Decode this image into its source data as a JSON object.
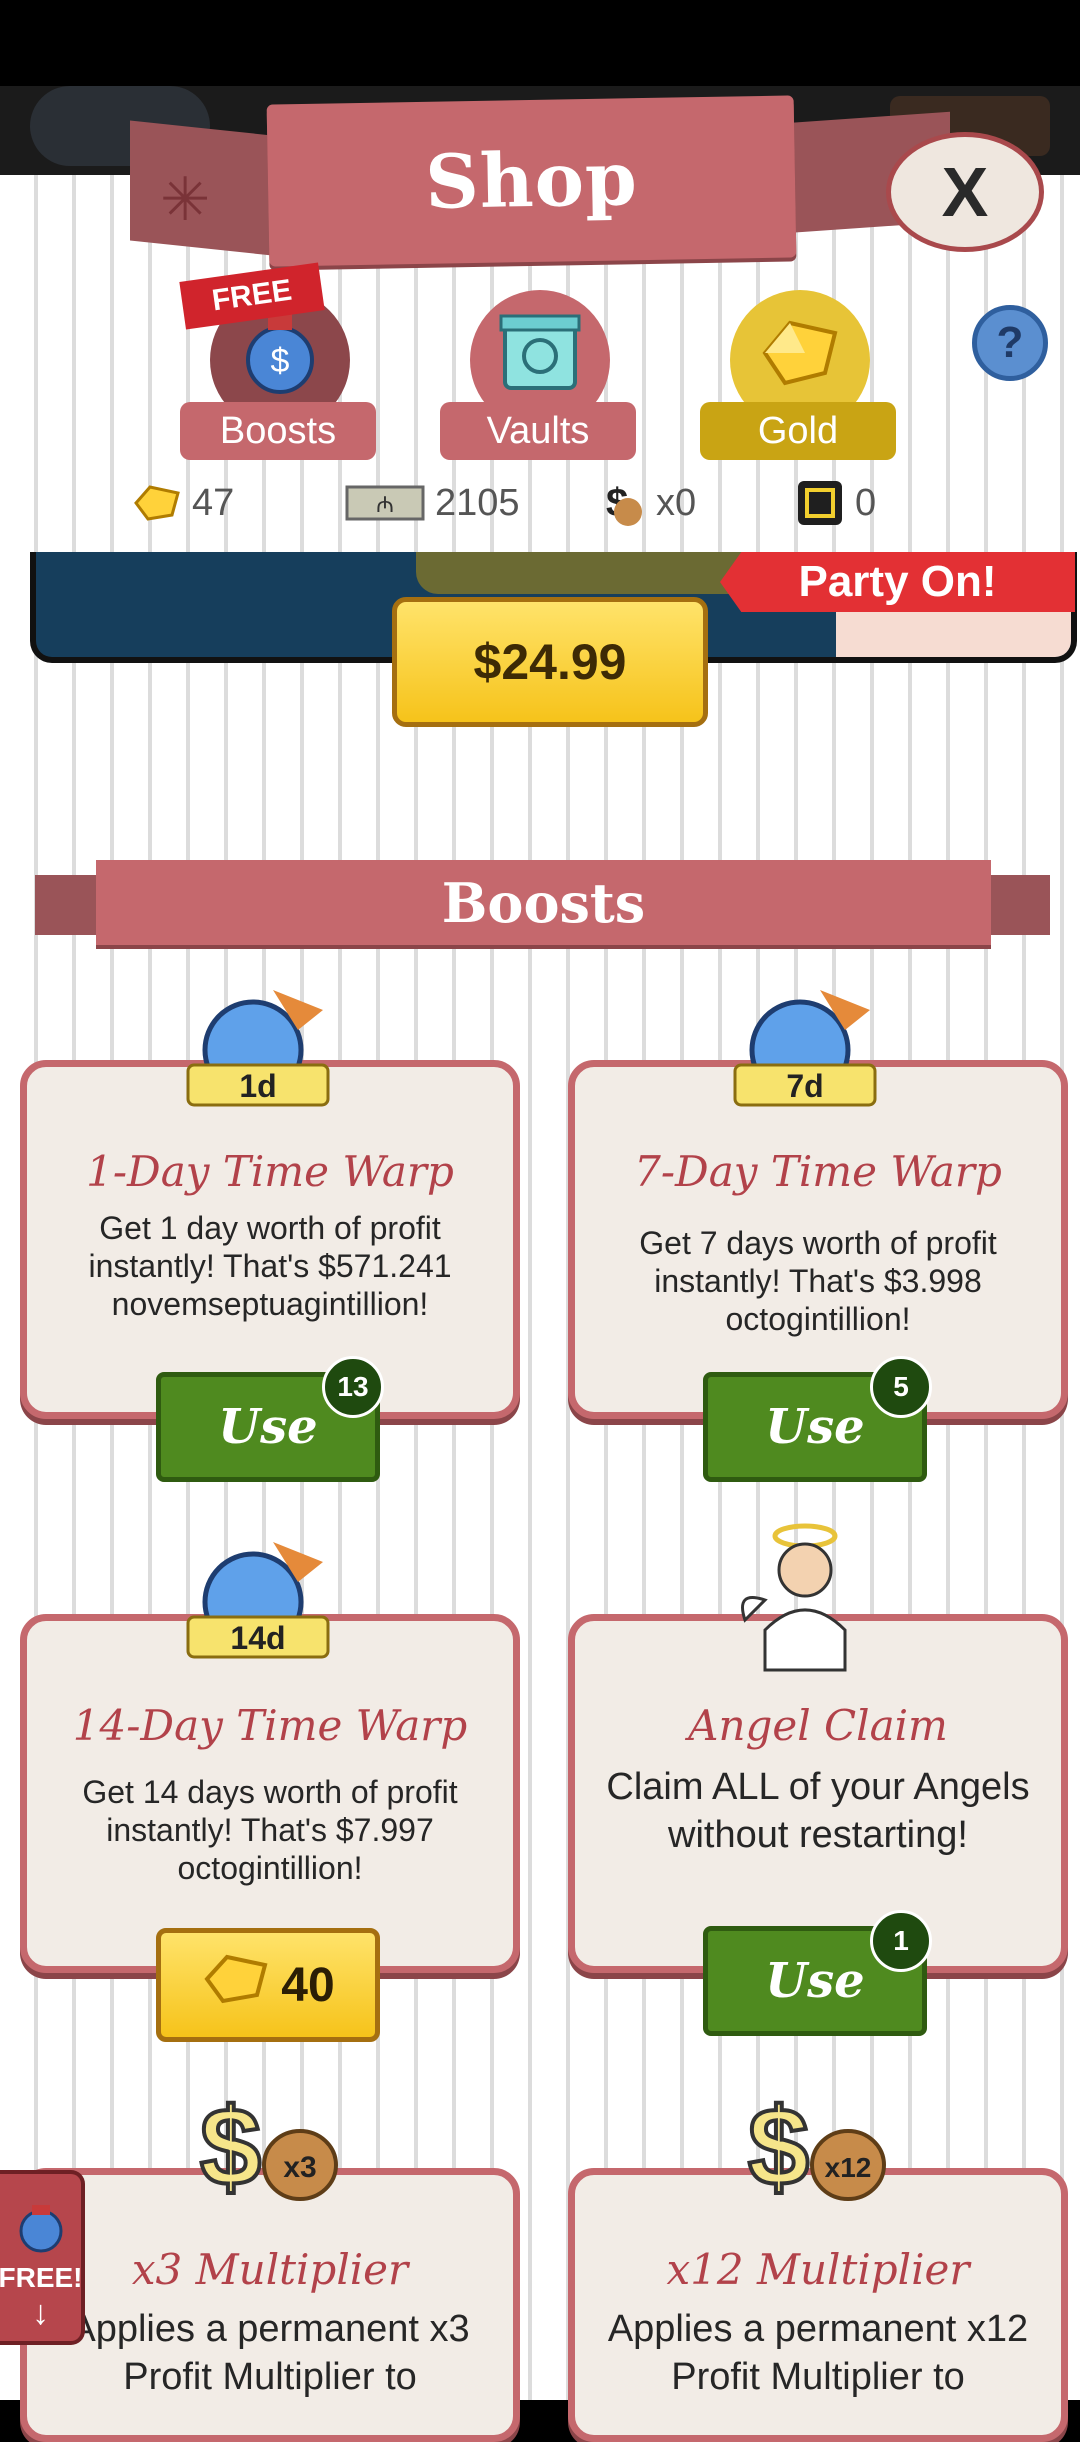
{
  "header": {
    "title": "Shop",
    "close_label": "X"
  },
  "tabs": [
    {
      "label": "Boosts",
      "badge": "FREE",
      "color": "#c5686d"
    },
    {
      "label": "Vaults",
      "color": "#c5686d"
    },
    {
      "label": "Gold",
      "color": "#c9a414"
    }
  ],
  "help_label": "?",
  "currencies": [
    {
      "icon": "gold-gem-icon",
      "value": "47"
    },
    {
      "icon": "megabucks-icon",
      "value": "2105"
    },
    {
      "icon": "money-bag-icon",
      "value": "x0"
    },
    {
      "icon": "ticket-icon",
      "value": "0"
    }
  ],
  "promo": {
    "banner_text": "Party On!",
    "price": "$24.99"
  },
  "section": {
    "title": "Boosts"
  },
  "boosts": [
    {
      "badge": "1d",
      "title": "1-Day Time Warp",
      "description": "Get 1 day worth of profit instantly! That's $571.241 novemseptuagintillion!",
      "button": "Use",
      "count": "13"
    },
    {
      "badge": "7d",
      "title": "7-Day Time Warp",
      "description": "Get 7 days worth of profit instantly! That's $3.998 octogintillion!",
      "button": "Use",
      "count": "5"
    },
    {
      "badge": "14d",
      "title": "14-Day Time Warp",
      "description": "Get 14 days worth of profit instantly! That's $7.997 octogintillion!",
      "price": "40"
    },
    {
      "title": "Angel Claim",
      "description": "Claim ALL of your Angels without restarting!",
      "button": "Use",
      "count": "1"
    },
    {
      "badge": "x3",
      "title": "x3 Multiplier",
      "description": "Applies a permanent x3 Profit Multiplier to"
    },
    {
      "badge": "x12",
      "title": "x12 Multiplier",
      "description": "Applies a permanent x12 Profit Multiplier to"
    }
  ],
  "free_side": {
    "label": "FREE!"
  },
  "colors": {
    "accent": "#c5686d",
    "use_green": "#4f8a1f",
    "gold": "#f6c31a"
  }
}
